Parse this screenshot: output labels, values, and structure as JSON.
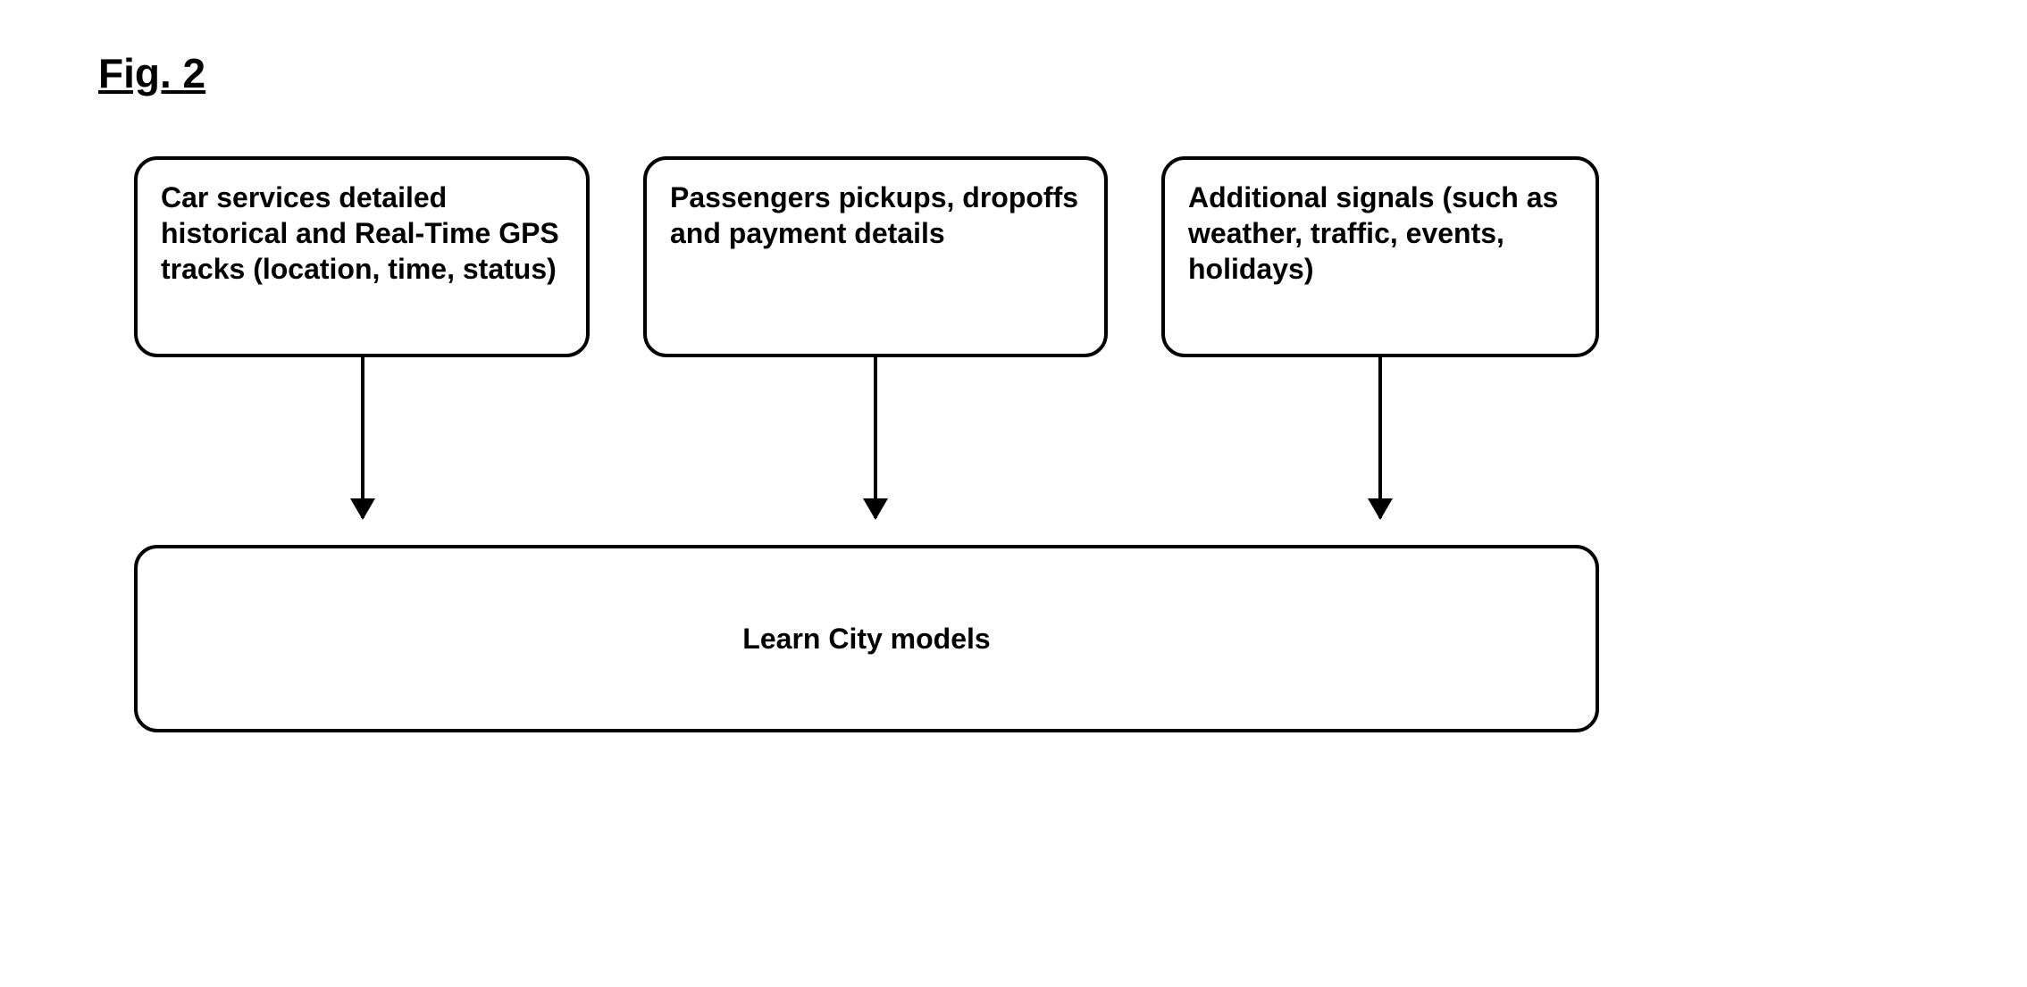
{
  "figure": {
    "title": "Fig. 2",
    "inputs": [
      "Car services detailed historical and Real-Time GPS tracks (location, time, status)",
      "Passengers pickups, dropoffs and payment details",
      "Additional signals (such as weather, traffic, events, holidays)"
    ],
    "process": "Learn City models"
  }
}
